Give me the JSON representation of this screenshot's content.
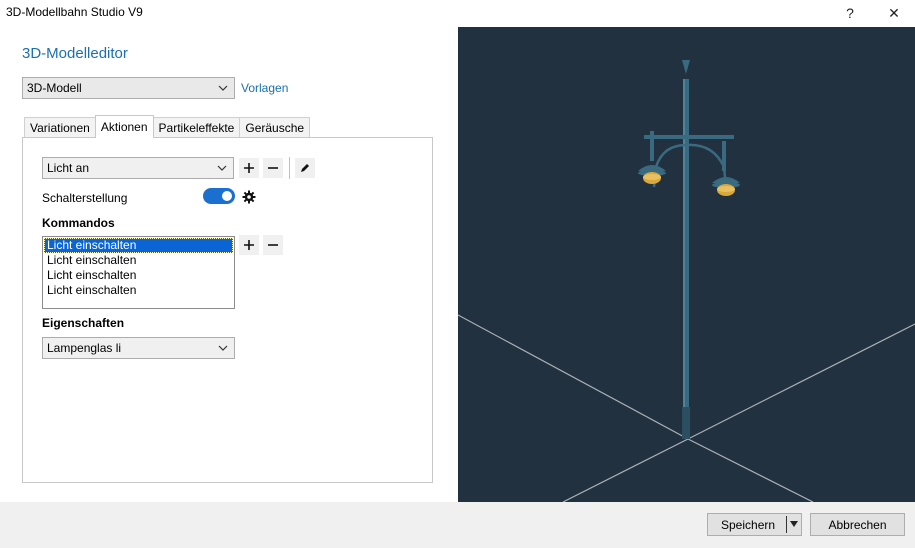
{
  "window": {
    "title": "3D-Modellbahn Studio V9",
    "help_label": "?",
    "close_label": "✕"
  },
  "editor": {
    "heading": "3D-Modelleditor",
    "model_select": "3D-Modell",
    "templates_link": "Vorlagen"
  },
  "tabs": [
    {
      "label": "Variationen",
      "active": false
    },
    {
      "label": "Aktionen",
      "active": true
    },
    {
      "label": "Partikeleffekte",
      "active": false
    },
    {
      "label": "Geräusche",
      "active": false
    }
  ],
  "actions": {
    "action_select": "Licht an",
    "add_label": "+",
    "remove_label": "−",
    "switch_label": "Schalterstellung",
    "switch_on": true,
    "commands_heading": "Kommandos",
    "commands": [
      "Licht einschalten",
      "Licht einschalten",
      "Licht einschalten",
      "Licht einschalten"
    ],
    "properties_heading": "Eigenschaften",
    "property_select": "Lampenglas li"
  },
  "footer": {
    "save_label": "Speichern",
    "cancel_label": "Abbrechen"
  },
  "colors": {
    "accent": "#1a6fb0",
    "viewport_bg": "#22313f",
    "lamp_pole": "#3a6a80",
    "lamp_glow": "#d8a83a"
  }
}
